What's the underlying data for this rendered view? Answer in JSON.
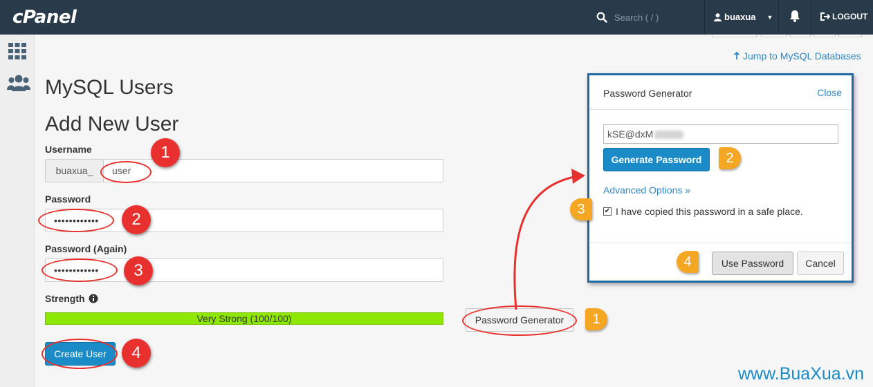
{
  "header": {
    "logo": "cPanel",
    "search_placeholder": "Search ( / )",
    "username": "buaxua",
    "logout_label": "LOGOUT"
  },
  "jump_link": "Jump to MySQL Databases",
  "page_title": "MySQL Users",
  "section_title": "Add New User",
  "form": {
    "username_label": "Username",
    "username_prefix": "buaxua_",
    "username_value": "user",
    "password_label": "Password",
    "password_value": "••••••••••••",
    "password_again_label": "Password (Again)",
    "password_again_value": "••••••••••••",
    "strength_label": "Strength",
    "strength_value": "Very Strong (100/100)",
    "strength_percent": 100,
    "password_generator_label": "Password Generator",
    "create_user_label": "Create User"
  },
  "popup": {
    "title": "Password Generator",
    "close_label": "Close",
    "password_value": "kSE@dxM",
    "generate_label": "Generate Password",
    "advanced_label": "Advanced Options »",
    "checkbox_label": "I have copied this password in a safe place.",
    "checkbox_checked": true,
    "use_label": "Use Password",
    "cancel_label": "Cancel"
  },
  "annotations": {
    "form_steps": [
      "1",
      "2",
      "3",
      "4"
    ],
    "popup_steps": [
      "1",
      "2",
      "3",
      "4"
    ]
  },
  "watermark": "www.BuaXua.vn",
  "colors": {
    "header_bg": "#293a4a",
    "primary": "#1a8bc7",
    "strength": "#8ee700",
    "annotation_red": "#e8312f",
    "annotation_orange": "#f5a623"
  }
}
